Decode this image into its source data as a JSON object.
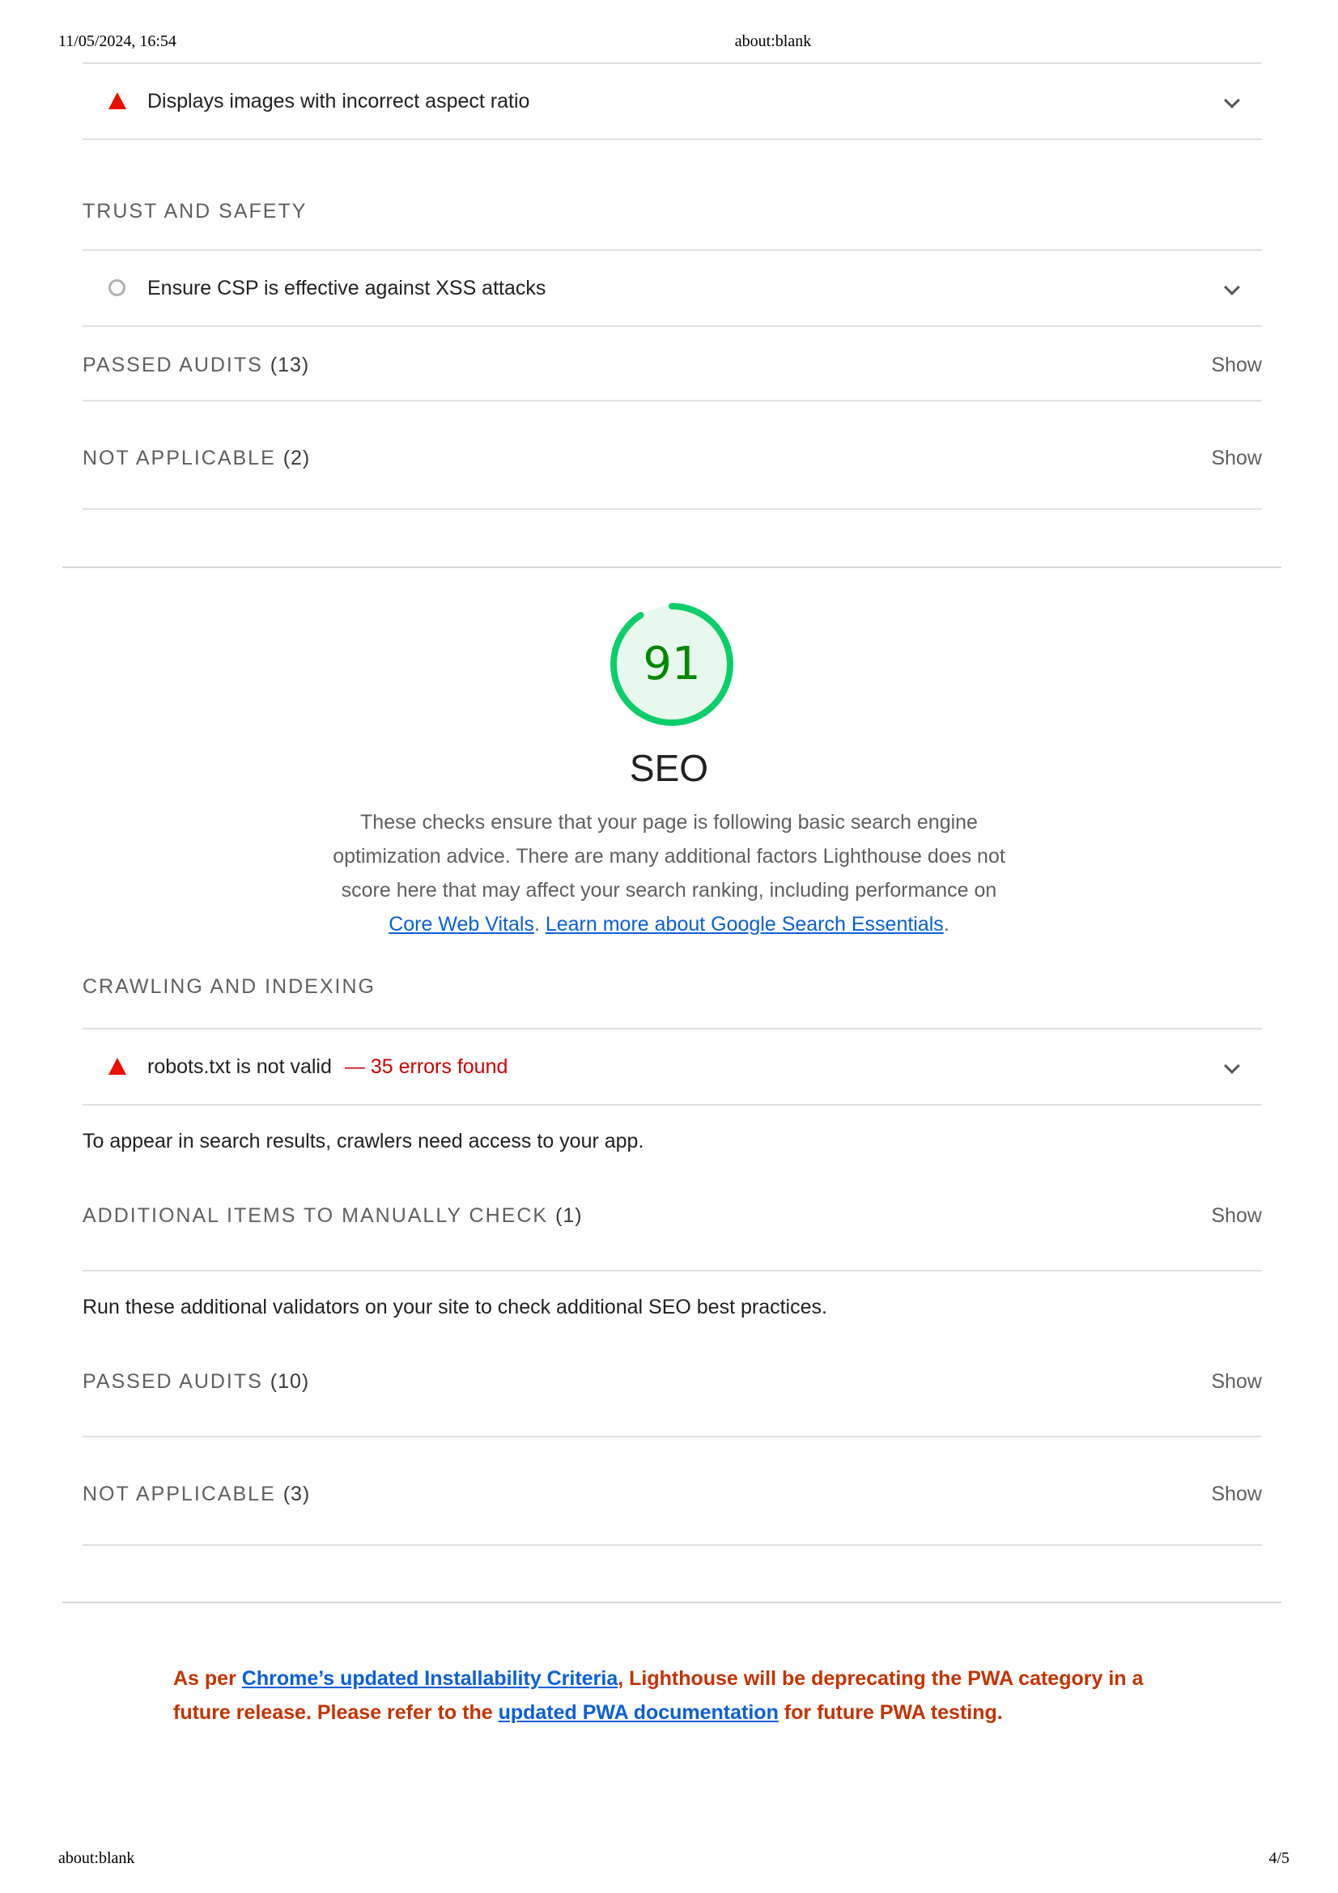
{
  "print_header": {
    "datetime": "11/05/2024, 16:54",
    "title": "about:blank"
  },
  "print_footer": {
    "url": "about:blank",
    "page": "4/5"
  },
  "best_practices_tail": {
    "audit_aspect": {
      "title": "Displays images with incorrect aspect ratio",
      "status": "fail"
    },
    "trust_group_title": "TRUST AND SAFETY",
    "audit_csp": {
      "title": "Ensure CSP is effective against XSS attacks",
      "status": "informative"
    },
    "passed": {
      "label": "PASSED AUDITS",
      "count": "(13)",
      "show": "Show"
    },
    "not_applicable": {
      "label": "NOT APPLICABLE",
      "count": "(2)",
      "show": "Show"
    }
  },
  "seo": {
    "score": "91",
    "score_fraction": 0.91,
    "gauge_color": "#0cce6b",
    "title": "SEO",
    "description": {
      "text": "These checks ensure that your page is following basic search engine optimization advice. There are many additional factors Lighthouse does not score here that may affect your search ranking, including performance on ",
      "link1": "Core Web Vitals",
      "sep": ". ",
      "link2": "Learn more about Google Search Essentials",
      "end": "."
    },
    "crawling_title": "CRAWLING AND INDEXING",
    "audit_robots": {
      "title": "robots.txt is not valid",
      "extra": "— 35 errors found",
      "status": "fail"
    },
    "crawling_desc": "To appear in search results, crawlers need access to your app.",
    "manual": {
      "label": "ADDITIONAL ITEMS TO MANUALLY CHECK",
      "count": "(1)",
      "show": "Show"
    },
    "manual_desc": "Run these additional validators on your site to check additional SEO best practices.",
    "passed": {
      "label": "PASSED AUDITS",
      "count": "(10)",
      "show": "Show"
    },
    "not_applicable": {
      "label": "NOT APPLICABLE",
      "count": "(3)",
      "show": "Show"
    }
  },
  "pwa_notice": {
    "part1": "As per ",
    "link1": "Chrome’s updated Installability Criteria",
    "part2": ", Lighthouse will be deprecating the PWA category in a future release. Please refer to the ",
    "link2": "updated PWA documentation",
    "part3": " for future PWA testing."
  },
  "colors": {
    "fail": "#eb0f00",
    "error_text": "#cc0000",
    "link": "#0b5fd6",
    "notice": "#c33300",
    "score_text": "#008800"
  }
}
